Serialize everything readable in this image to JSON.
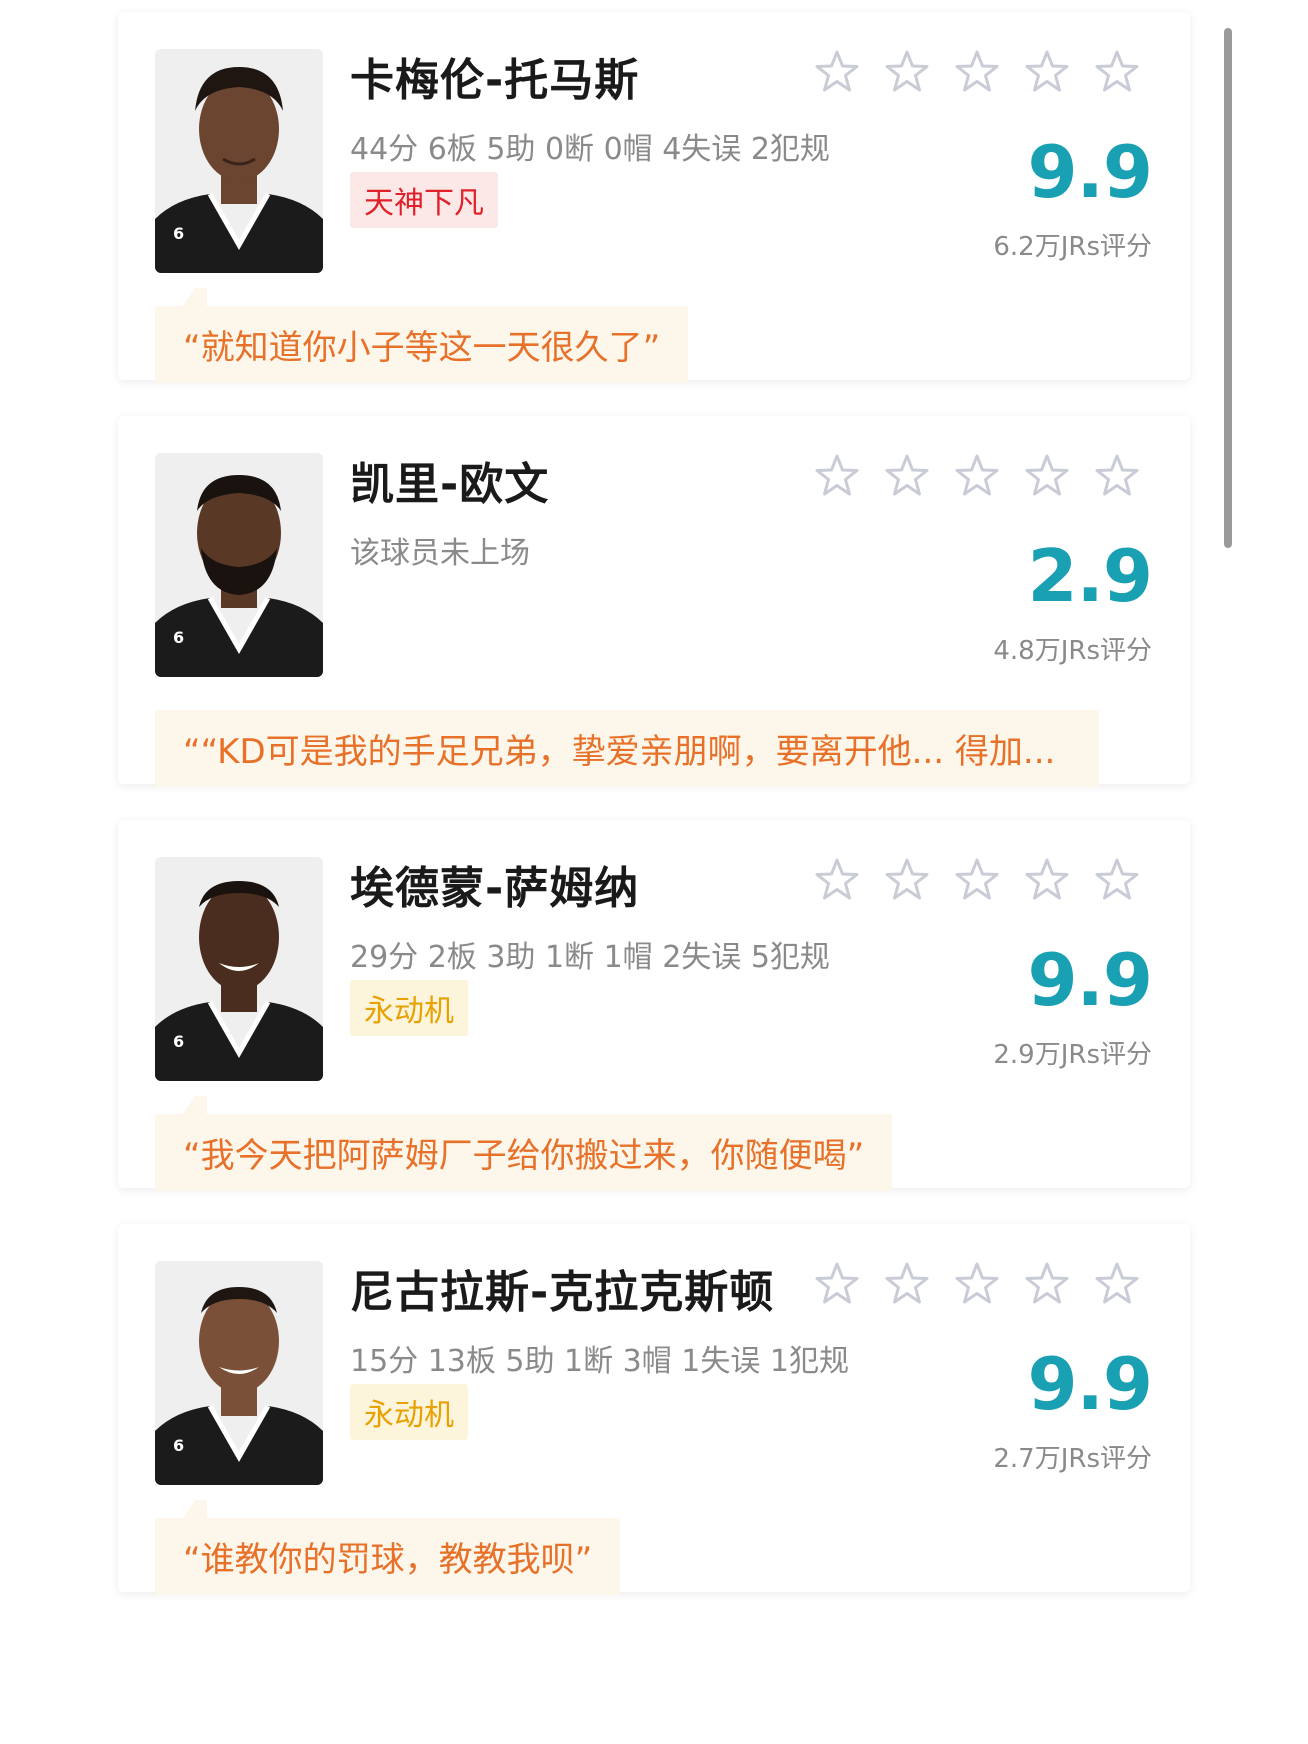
{
  "players": [
    {
      "name": "卡梅伦-托马斯",
      "stats": "44分 6板 5助 0断 0帽 4失误 2犯规",
      "badge": "天神下凡",
      "badge_color": "#e0212a",
      "score": "9.9",
      "votes": "6.2万JRs评分",
      "quote": "“就知道你小子等这一天很久了”",
      "stars_filled": 0,
      "jersey_number": "6"
    },
    {
      "name": "凯里-欧文",
      "stats": "该球员未上场",
      "badge": "",
      "badge_color": "",
      "score": "2.9",
      "votes": "4.8万JRs评分",
      "quote": "““KD可是我的手足兄弟，挚爱亲朋啊，要离开他... 得加...",
      "stars_filled": 0,
      "jersey_number": "6"
    },
    {
      "name": "埃德蒙-萨姆纳",
      "stats": "29分 2板 3助 1断 1帽 2失误 5犯规",
      "badge": "永动机",
      "badge_color": "#e8a100",
      "score": "9.9",
      "votes": "2.9万JRs评分",
      "quote": "“我今天把阿萨姆厂子给你搬过来，你随便喝”",
      "stars_filled": 0,
      "jersey_number": "6"
    },
    {
      "name": "尼古拉斯-克拉克斯顿",
      "stats": "15分 13板 5助 1断 3帽 1失误 1犯规",
      "badge": "永动机",
      "badge_color": "#e8a100",
      "score": "9.9",
      "votes": "2.7万JRs评分",
      "quote": "“谁教你的罚球，教教我呗”",
      "stars_filled": 0,
      "jersey_number": "6"
    }
  ],
  "icons": {
    "star": "star-outline-icon",
    "avatar": "player-avatar"
  },
  "colors": {
    "score": "#1aa0b3",
    "quote_text": "#e8712a",
    "quote_bg": "#fdf6ea",
    "star_outline": "#c9ccd6"
  }
}
